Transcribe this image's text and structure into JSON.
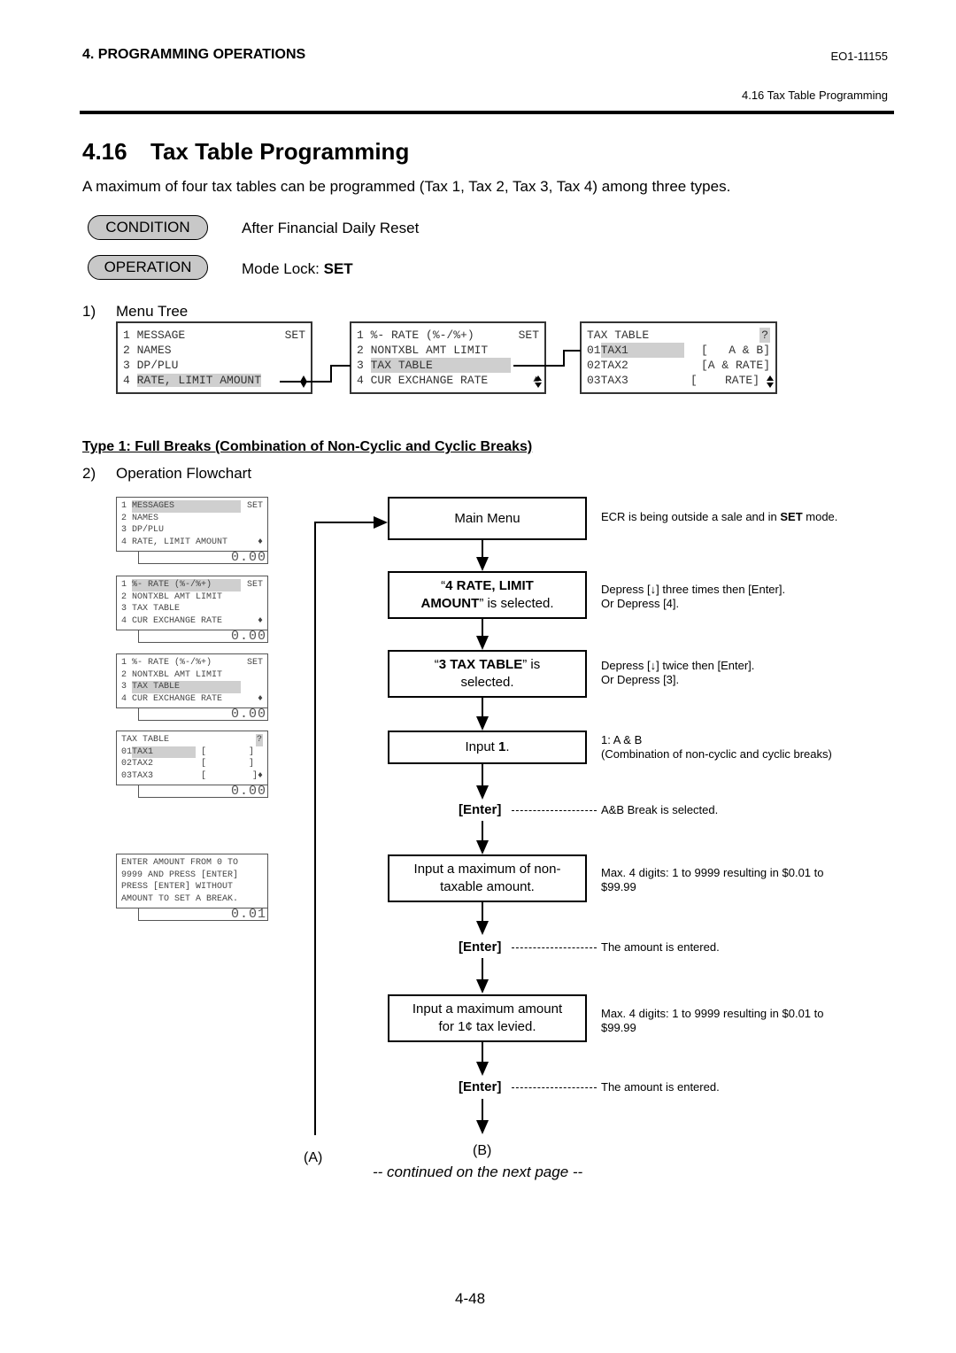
{
  "header": {
    "section": "4. PROGRAMMING OPERATIONS",
    "doc_id": "EO1-11155",
    "subsection": "4.16 Tax Table Programming"
  },
  "title": {
    "number": "4.16",
    "text": "Tax Table Programming"
  },
  "intro": "A maximum of four tax tables can be programmed (Tax 1, Tax 2, Tax 3, Tax 4) among three types.",
  "condition": {
    "label": "CONDITION",
    "text": "After Financial Daily Reset"
  },
  "operation": {
    "label": "OPERATION",
    "text_prefix": "Mode Lock: ",
    "text_bold": "SET"
  },
  "menu_tree": {
    "step_num": "1)",
    "step_label": "Menu Tree",
    "screens": [
      {
        "rows": [
          "1 MESSAGE",
          "2 NAMES",
          "3 DP/PLU",
          "4 RATE, LIMIT AMOUNT"
        ],
        "corner": "SET",
        "highlight_row": 3
      },
      {
        "rows": [
          "1 %- RATE (%-/%+)",
          "2 NONTXBL AMT LIMIT",
          "3 TAX TABLE",
          "4 CUR EXCHANGE RATE"
        ],
        "corner": "SET",
        "highlight_row": 2
      },
      {
        "title": "TAX TABLE",
        "corner": "?",
        "rows": [
          {
            "num": "01",
            "name": "TAX1",
            "value": "[   A & B]"
          },
          {
            "num": "02",
            "name": "TAX2",
            "value": "[A & RATE]"
          },
          {
            "num": "03",
            "name": "TAX3",
            "value": "[    RATE]"
          }
        ],
        "highlight_row": 0
      }
    ]
  },
  "type_heading": "Type 1: Full Breaks (Combination of Non-Cyclic and Cyclic Breaks)",
  "flowchart": {
    "step_num": "2)",
    "step_label": "Operation Flowchart",
    "lcd_screens": [
      {
        "rows": [
          "1 MESSAGES",
          "2 NAMES",
          "3 DP/PLU",
          "4 RATE, LIMIT AMOUNT"
        ],
        "corner": "SET",
        "amount": "0.00"
      },
      {
        "rows": [
          "1 %- RATE (%-/%+)",
          "2 NONTXBL AMT LIMIT",
          "3 TAX TABLE",
          "4 CUR EXCHANGE RATE"
        ],
        "corner": "SET",
        "amount": "0.00"
      },
      {
        "rows": [
          "1 %- RATE (%-/%+)",
          "2 NONTXBL AMT LIMIT",
          "3 TAX TABLE",
          "4 CUR EXCHANGE RATE"
        ],
        "corner": "SET",
        "amount": "0.00"
      },
      {
        "title": "TAX TABLE",
        "corner": "?",
        "rows": [
          {
            "num": "01",
            "name": "TAX1",
            "value": "[        ]"
          },
          {
            "num": "02",
            "name": "TAX2",
            "value": "[        ]"
          },
          {
            "num": "03",
            "name": "TAX3",
            "value": "[        ]"
          }
        ],
        "amount": "0.00"
      },
      {
        "rows": [
          "ENTER AMOUNT FROM 0 TO",
          "9999 AND PRESS [ENTER]",
          "PRESS [ENTER] WITHOUT",
          "AMOUNT TO SET A BREAK."
        ],
        "amount": "0.01"
      }
    ],
    "steps": [
      {
        "box": "Main Menu",
        "note_prefix": "ECR is being outside a sale and in ",
        "note_bold": "SET",
        "note_suffix": " mode."
      },
      {
        "box_bold1": "4 RATE, LIMIT",
        "box_bold2": "AMOUNT",
        "box_rest": "” is selected.",
        "note_line1": "Depress [↓] three times then [Enter].",
        "note_line2": "Or Depress [4]."
      },
      {
        "box_bold": "3 TAX TABLE",
        "box_rest1": "” is",
        "box_rest2": "selected.",
        "note_line1": "Depress [↓] twice then [Enter].",
        "note_line2": "Or Depress [3]."
      },
      {
        "box_prefix": "Input ",
        "box_bold": "1",
        "box_suffix": ".",
        "note_line1": "1: A & B",
        "note_line2": "(Combination of non-cyclic and cyclic breaks)"
      },
      {
        "key": "[Enter]",
        "note": "A&B Break is selected."
      },
      {
        "box_line1": "Input a maximum of non-",
        "box_line2": "taxable amount.",
        "note_line1": "Max. 4 digits: 1 to 9999 resulting in $0.01 to",
        "note_line2": "$99.99"
      },
      {
        "key": "[Enter]",
        "note": "The amount is entered."
      },
      {
        "box_line1": "Input a maximum amount",
        "box_line2": "for 1¢ tax levied.",
        "note_line1": "Max. 4 digits: 1 to 9999 resulting in $0.01 to",
        "note_line2": "$99.99"
      },
      {
        "key": "[Enter]",
        "note": "The amount is entered."
      }
    ],
    "connector_a": "(A)",
    "connector_b": "(B)",
    "continued": "-- continued on the next page  --"
  },
  "page_number": "4-48"
}
